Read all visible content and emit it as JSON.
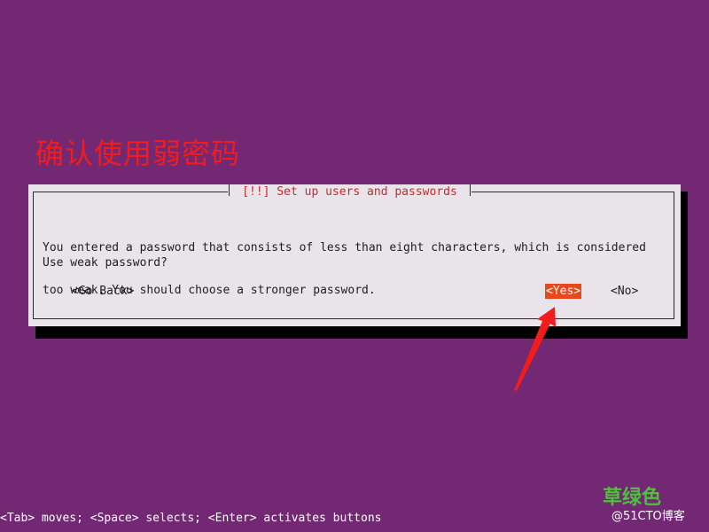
{
  "annotation": {
    "title": "确认使用弱密码"
  },
  "dialog": {
    "title": "[!!] Set up users and passwords",
    "message_line_1": "You entered a password that consists of less than eight characters, which is considered",
    "message_line_2": "too weak. You should choose a stronger password.",
    "question": "Use weak password?",
    "buttons": {
      "go_back": "<Go Back>",
      "yes": "<Yes>",
      "no": "<No>"
    },
    "selected_button": "yes"
  },
  "help_bar": {
    "text": "<Tab> moves; <Space> selects; <Enter> activates buttons"
  },
  "watermark": {
    "brand": "草绿色",
    "site": "@51CTO博客"
  },
  "colors": {
    "background": "#722872",
    "dialog": "#e9e4ea",
    "title_red": "#cc2a2a",
    "highlight": "#e64a1c",
    "annotation_red": "#f21c1c"
  }
}
